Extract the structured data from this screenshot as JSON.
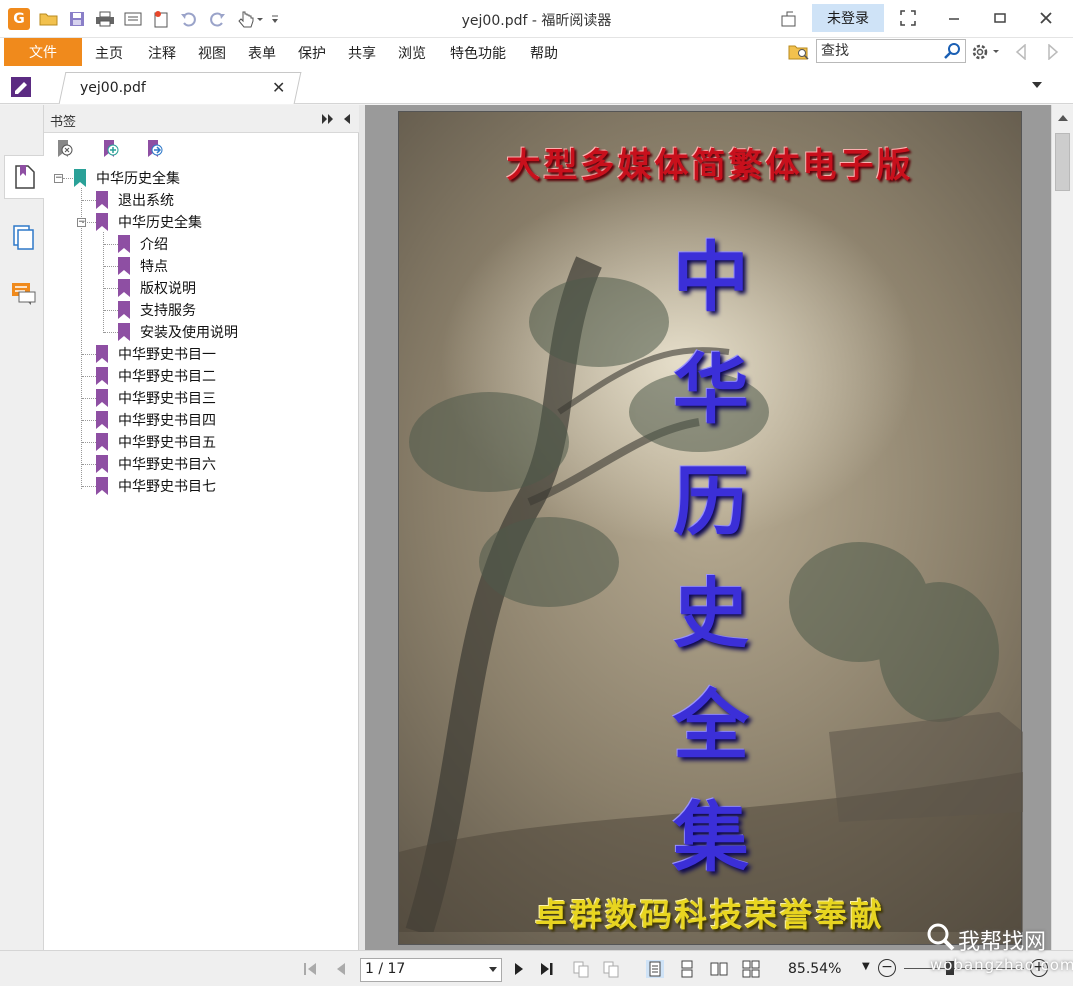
{
  "window": {
    "title": "yej00.pdf - 福昕阅读器",
    "login_label": "未登录"
  },
  "menu": {
    "file_label": "文件",
    "items": [
      "主页",
      "注释",
      "视图",
      "表单",
      "保护",
      "共享",
      "浏览",
      "特色功能",
      "帮助"
    ]
  },
  "search": {
    "placeholder": "查找"
  },
  "tab": {
    "label": "yej00.pdf"
  },
  "bookmarks": {
    "panel_title": "书签",
    "items": [
      {
        "label": "中华历史全集",
        "level": 0,
        "color": "#2aa198"
      },
      {
        "label": "退出系统",
        "level": 1,
        "color": "#8e4fa3"
      },
      {
        "label": "中华历史全集",
        "level": 1,
        "color": "#8e4fa3"
      },
      {
        "label": "介绍",
        "level": 2,
        "color": "#8e4fa3"
      },
      {
        "label": "特点",
        "level": 2,
        "color": "#8e4fa3"
      },
      {
        "label": "版权说明",
        "level": 2,
        "color": "#8e4fa3"
      },
      {
        "label": "支持服务",
        "level": 2,
        "color": "#8e4fa3"
      },
      {
        "label": "安装及使用说明",
        "level": 2,
        "color": "#8e4fa3"
      },
      {
        "label": "中华野史书目一",
        "level": 1,
        "color": "#8e4fa3"
      },
      {
        "label": "中华野史书目二",
        "level": 1,
        "color": "#8e4fa3"
      },
      {
        "label": "中华野史书目三",
        "level": 1,
        "color": "#8e4fa3"
      },
      {
        "label": "中华野史书目四",
        "level": 1,
        "color": "#8e4fa3"
      },
      {
        "label": "中华野史书目五",
        "level": 1,
        "color": "#8e4fa3"
      },
      {
        "label": "中华野史书目六",
        "level": 1,
        "color": "#8e4fa3"
      },
      {
        "label": "中华野史书目七",
        "level": 1,
        "color": "#8e4fa3"
      }
    ]
  },
  "document": {
    "top_text": "大型多媒体简繁体电子版",
    "main_title_chars": [
      "中",
      "华",
      "历",
      "史",
      "全",
      "集"
    ],
    "bottom_text": "卓群数码科技荣誉奉献"
  },
  "status": {
    "page_indicator": "1 / 17",
    "zoom": "85.54%"
  },
  "watermark": {
    "text": "我帮找网",
    "sub": "wobangzhao.com"
  },
  "colors": {
    "accent": "#f08a1c",
    "login_bg": "#cfe3f7",
    "bookmark": "#8e4fa3",
    "bookmark_root": "#2aa198"
  }
}
